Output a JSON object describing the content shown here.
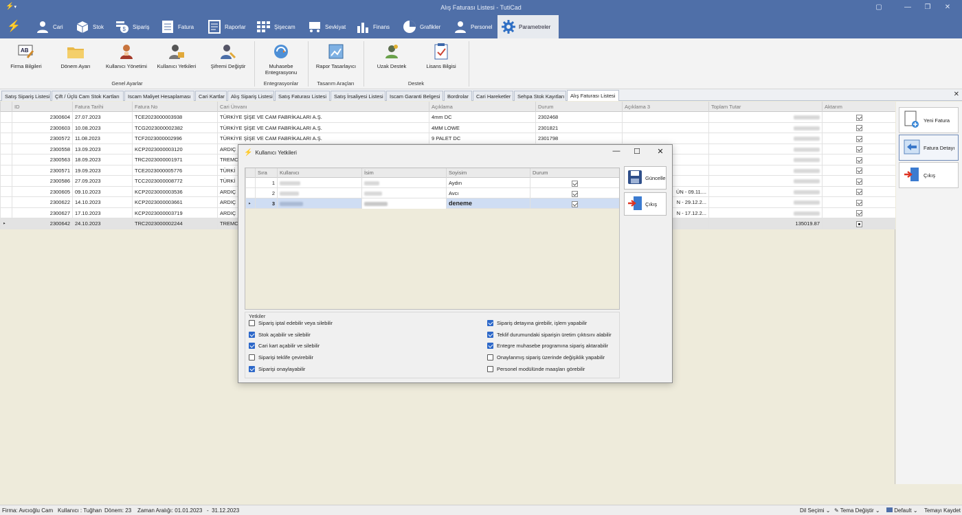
{
  "window": {
    "title": "Alış Faturası Listesi - TutiCad"
  },
  "menu": [
    {
      "label": "Cari",
      "icon": "person-icon"
    },
    {
      "label": "Stok",
      "icon": "box-icon"
    },
    {
      "label": "Sipariş",
      "icon": "order-icon"
    },
    {
      "label": "Fatura",
      "icon": "invoice-icon"
    },
    {
      "label": "Raporlar",
      "icon": "report-icon"
    },
    {
      "label": "Şişecam",
      "icon": "grid-icon"
    },
    {
      "label": "Sevkiyat",
      "icon": "cart-icon"
    },
    {
      "label": "Finans",
      "icon": "bar-chart-icon"
    },
    {
      "label": "Grafikler",
      "icon": "pie-chart-icon"
    },
    {
      "label": "Personel",
      "icon": "staff-icon"
    },
    {
      "label": "Parametreler",
      "icon": "gear-icon"
    }
  ],
  "ribbon": {
    "buttons": [
      "Firma Bilgileri",
      "Dönem Ayarı",
      "Kullanıcı Yönetimi",
      "Kullanıcı Yetkileri",
      "Şifremi Değiştir",
      "Muhasebe Entegrasyonu",
      "Rapor Tasarlayıcı",
      "Uzak Destek",
      "Lisans Bilgisi"
    ],
    "groups": [
      "Genel Ayarlar",
      "Entegrasyonlar",
      "Tasarım Araçları",
      "Destek"
    ]
  },
  "tabs": [
    "Satış Sipariş Listesi",
    "Çift / Üçlü Cam Stok Kartları",
    "Iscam Maliyet Hesaplaması",
    "Cari Kartlar",
    "Alış Sipariş Listesi",
    "Satış Faturası Listesi",
    "Satış İrsaliyesi Listesi",
    "Iscam Garanti Belgesi",
    "Bordrolar",
    "Cari Hareketler",
    "Sehpa Stok Kayıtları",
    "Alış Faturası Listesi"
  ],
  "grid": {
    "columns": [
      "ID",
      "Fatura Tarihi",
      "Fatura No",
      "Cari Ünvanı",
      "Açıklama",
      "Durum",
      "Açıklama 3",
      "Toplam Tutar",
      "Aktarım"
    ],
    "rows": [
      {
        "id": "2300604",
        "date": "27.07.2023",
        "no": "TCE2023000003938",
        "cari": "TÜRKİYE ŞİŞE VE CAM FABRİKALARI A.Ş.",
        "desc": "4mm DC",
        "status": "2302468",
        "desc3": "",
        "total": "",
        "aktarim": true
      },
      {
        "id": "2300603",
        "date": "10.08.2023",
        "no": "TCG2023000002382",
        "cari": "TÜRKİYE ŞİŞE VE CAM FABRİKALARI A.Ş.",
        "desc": "4MM LOWE",
        "status": "2301821",
        "desc3": "",
        "total": "",
        "aktarim": true
      },
      {
        "id": "2300572",
        "date": "11.08.2023",
        "no": "TCF2023000002996",
        "cari": "TÜRKİYE ŞİŞE VE CAM FABRİKALARI A.Ş.",
        "desc": "9 PALET DC",
        "status": "2301798",
        "desc3": "",
        "total": "",
        "aktarim": true
      },
      {
        "id": "2300558",
        "date": "13.09.2023",
        "no": "KCP2023000003120",
        "cari": "ARDIÇ",
        "desc": "",
        "status": "",
        "desc3": "",
        "total": "",
        "aktarim": true
      },
      {
        "id": "2300563",
        "date": "18.09.2023",
        "no": "TRC2023000001971",
        "cari": "TREMC",
        "desc": "",
        "status": "",
        "desc3": "",
        "total": "",
        "aktarim": true
      },
      {
        "id": "2300571",
        "date": "19.09.2023",
        "no": "TCE2023000005776",
        "cari": "TÜRKİ",
        "desc": "",
        "status": "",
        "desc3": "",
        "total": "",
        "aktarim": true
      },
      {
        "id": "2300586",
        "date": "27.09.2023",
        "no": "TCC2023000008772",
        "cari": "TÜRKİ",
        "desc": "",
        "status": "",
        "desc3": "",
        "total": "",
        "aktarim": true
      },
      {
        "id": "2300605",
        "date": "09.10.2023",
        "no": "KCP2023000003536",
        "cari": "ARDIÇ",
        "desc": "",
        "status": "",
        "desc3": "ÜN - 09.11....",
        "total": "",
        "aktarim": true
      },
      {
        "id": "2300622",
        "date": "14.10.2023",
        "no": "KCP2023000003661",
        "cari": "ARDIÇ",
        "desc": "",
        "status": "",
        "desc3": "N - 29.12.2...",
        "total": "",
        "aktarim": true
      },
      {
        "id": "2300627",
        "date": "17.10.2023",
        "no": "KCP2023000003719",
        "cari": "ARDIÇ",
        "desc": "",
        "status": "",
        "desc3": "N - 17.12.2...",
        "total": "",
        "aktarim": true
      },
      {
        "id": "2300642",
        "date": "24.10.2023",
        "no": "TRC2023000002244",
        "cari": "TREMC",
        "desc": "",
        "status": "",
        "desc3": "",
        "total": "135019.87",
        "aktarim": false
      }
    ]
  },
  "side_buttons": [
    "Yeni Fatura",
    "Fatura Detayı",
    "Çıkış"
  ],
  "dialog": {
    "title": "Kullanıcı Yetkileri",
    "columns": [
      "Sıra",
      "Kullanıcı",
      "İsim",
      "Soyisim",
      "Durum"
    ],
    "rows": [
      {
        "sira": "1",
        "soyisim": "Aydın",
        "durum": true
      },
      {
        "sira": "2",
        "soyisim": "Avcı",
        "durum": true
      },
      {
        "sira": "3",
        "soyisim": "deneme",
        "durum": true
      }
    ],
    "buttons": [
      "Güncelle",
      "Çıkış"
    ],
    "perm_title": "Yetkiler",
    "permissions_left": [
      {
        "label": "Sipariş iptal edebilir veya silebilir",
        "checked": false
      },
      {
        "label": "Stok açabilir ve silebilir",
        "checked": true
      },
      {
        "label": "Cari kart açabilir ve silebilir",
        "checked": true
      },
      {
        "label": "Siparişi teklife çevirebilir",
        "checked": false
      },
      {
        "label": "Siparişi onaylayabilir",
        "checked": true
      }
    ],
    "permissions_right": [
      {
        "label": "Sipariş detayına girebilir, işlem yapabilir",
        "checked": true
      },
      {
        "label": "Teklif durumundaki siparişin üretim çıktısını alabilir",
        "checked": true
      },
      {
        "label": "Entegre muhasebe programına sipariş aktarabilir",
        "checked": true
      },
      {
        "label": "Onaylanmış sipariş üzerinde değişiklik yapabilir",
        "checked": false
      },
      {
        "label": "Personel modülünde maaşları görebilir",
        "checked": false
      }
    ]
  },
  "status": {
    "firma_label": "Firma:",
    "firma": "Avcıoğlu Cam",
    "kullanici_label": "Kullanıcı :",
    "kullanici": "Tuğhan",
    "donem_label": "Dönem:",
    "donem": "23",
    "aralik_label": "Zaman Aralığı:",
    "aralik_start": "01.01.2023",
    "aralik_sep": "-",
    "aralik_end": "31.12.2023",
    "dil": "Dil Seçimi",
    "tema": "Tema Değiştir",
    "default": "Default",
    "kaydet": "Temayı Kaydet"
  },
  "colors": {
    "menu": "#4f6fa8",
    "accent": "#2d68c9",
    "selected_row": "#cfddf3"
  }
}
